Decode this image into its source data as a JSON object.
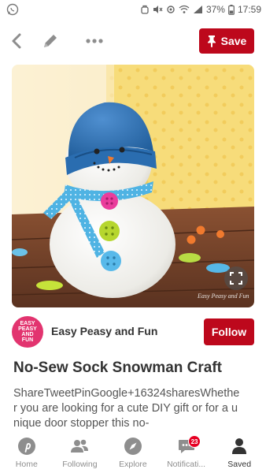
{
  "status_bar": {
    "battery": "37%",
    "time": "17:59",
    "icons": [
      "whatsapp-icon",
      "alarm-icon",
      "mute-icon",
      "location-icon",
      "wifi-icon",
      "signal-icon",
      "battery-icon"
    ]
  },
  "top_bar": {
    "back_icon": "chevron-left-icon",
    "edit_icon": "pencil-icon",
    "more_icon": "more-dots-icon",
    "save_label": "Save"
  },
  "pin": {
    "image_alt": "snowman",
    "watermark": "Easy Peasy and Fun",
    "creator": {
      "avatar_lines": [
        "EASY",
        "PEASY AND",
        "FUN"
      ],
      "name": "Easy Peasy and Fun",
      "follow_label": "Follow"
    },
    "title": "No-Sew Sock Snowman Craft",
    "description": "ShareTweetPinGoogle+16324sharesWhether you are looking for a cute DIY gift or for a unique door stopper this no-"
  },
  "bottom_nav": {
    "items": [
      {
        "label": "Home",
        "icon": "pinterest-icon"
      },
      {
        "label": "Following",
        "icon": "people-icon"
      },
      {
        "label": "Explore",
        "icon": "compass-icon"
      },
      {
        "label": "Notificati...",
        "icon": "chat-bubble-icon",
        "badge": "23"
      },
      {
        "label": "Saved",
        "icon": "person-icon"
      }
    ]
  },
  "colors": {
    "accent": "#bd081c",
    "avatar": "#e2346f",
    "badge": "#e60023"
  }
}
